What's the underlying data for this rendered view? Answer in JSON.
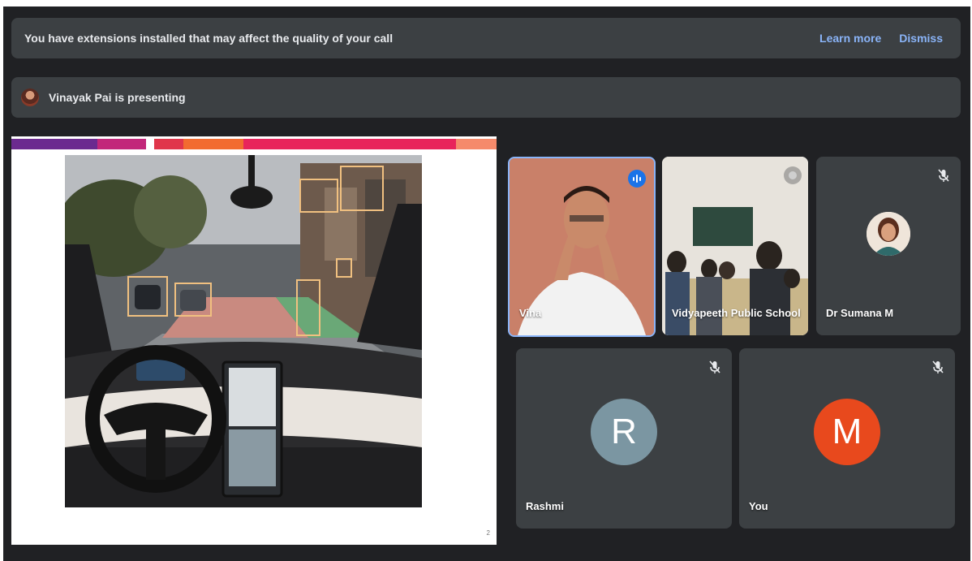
{
  "extension_banner": {
    "message": "You have extensions installed that may affect the quality of your call",
    "learn_more": "Learn more",
    "dismiss": "Dismiss"
  },
  "presenting_banner": {
    "message": "Vinayak Pai is presenting"
  },
  "slide": {
    "stripe_colors": [
      "#6b2a8f",
      "#c2277a",
      "#ffffff",
      "#e0364b",
      "#f26b30",
      "#e8245b",
      "#f58a6b"
    ],
    "page_number": "2"
  },
  "participants": [
    {
      "id": "vinayak",
      "name": "Vina",
      "state": "speaking",
      "tile_color": "#c98069"
    },
    {
      "id": "vidyapeeth",
      "name": "Vidyapeeth Public School",
      "state": "pinned",
      "tile_color": "#e7e3dc"
    },
    {
      "id": "sumana",
      "name": "Dr Sumana M",
      "state": "muted"
    },
    {
      "id": "rashmi",
      "name": "Rashmi",
      "state": "muted",
      "initial": "R",
      "avatar_color": "#7b96a2"
    },
    {
      "id": "you",
      "name": "You",
      "state": "muted",
      "initial": "M",
      "avatar_color": "#e8491d"
    }
  ],
  "colors": {
    "background": "#202124",
    "banner": "#3c4043",
    "link": "#8ab4f8",
    "active_speaker": "#8ab4f8"
  }
}
